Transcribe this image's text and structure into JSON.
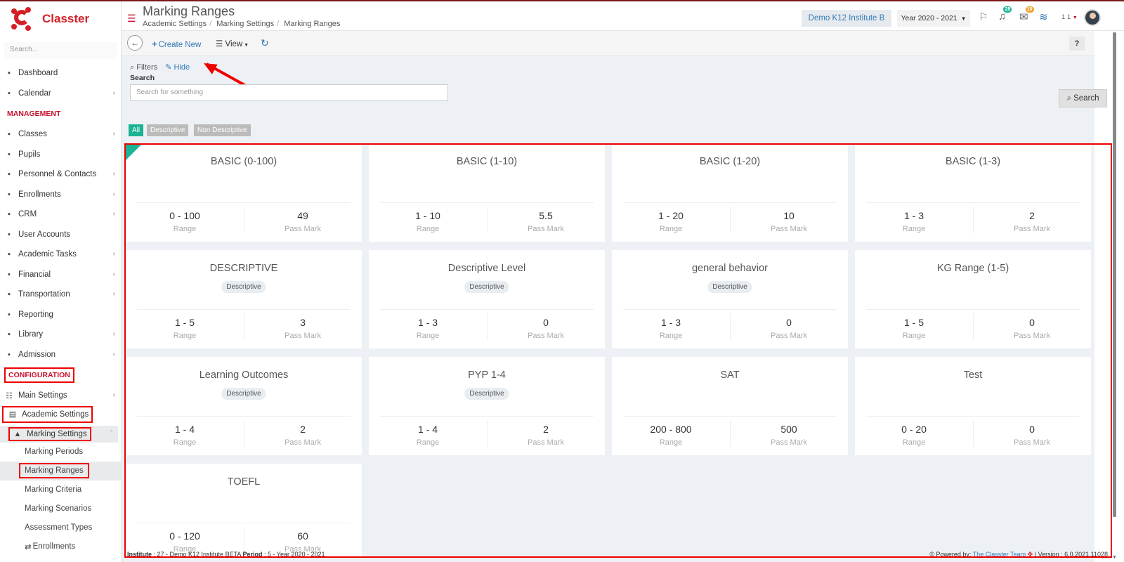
{
  "app": {
    "name": "Classter"
  },
  "sidebar": {
    "search_placeholder": "Search...",
    "items_top": [
      {
        "label": "Dashboard",
        "icon": "laptop-icon"
      },
      {
        "label": "Calendar",
        "icon": "calendar-icon"
      }
    ],
    "section_management": "MANAGEMENT",
    "items_management": [
      {
        "label": "Classes",
        "icon": "classes-icon"
      },
      {
        "label": "Pupils",
        "icon": "pupils-icon"
      },
      {
        "label": "Personnel & Contacts",
        "icon": "personnel-icon"
      },
      {
        "label": "Enrollments",
        "icon": "enrollments-icon"
      },
      {
        "label": "CRM",
        "icon": "crm-icon"
      },
      {
        "label": "User Accounts",
        "icon": "key-icon"
      },
      {
        "label": "Academic Tasks",
        "icon": "tasks-icon"
      },
      {
        "label": "Financial",
        "icon": "coins-icon"
      },
      {
        "label": "Transportation",
        "icon": "bus-icon"
      },
      {
        "label": "Reporting",
        "icon": "printer-icon"
      },
      {
        "label": "Library",
        "icon": "books-icon"
      },
      {
        "label": "Admission",
        "icon": "institution-icon"
      }
    ],
    "section_configuration": "CONFIGURATION",
    "main_settings": "Main Settings",
    "academic_settings": "Academic Settings",
    "marking_settings": "Marking Settings",
    "sub_items": [
      "Marking Periods",
      "Marking Ranges",
      "Marking Criteria",
      "Marking Scenarios",
      "Assessment Types"
    ],
    "enrollments_sub": "Enrollments"
  },
  "header": {
    "title": "Marking Ranges",
    "breadcrumbs": [
      "Academic Settings",
      "Marking Settings",
      "Marking Ranges"
    ],
    "institute": "Demo K12 Institute B",
    "year": "Year 2020 - 2021",
    "notifications_count": "28",
    "messages_count": "10",
    "user_num": "1 1"
  },
  "toolbar": {
    "create_label": "Create New",
    "view_label": "View",
    "help_label": "?"
  },
  "filters": {
    "label": "Filters",
    "hide_label": "Hide",
    "search_label": "Search",
    "search_placeholder": "Search for something",
    "search_button": "Search",
    "pills": [
      "All",
      "Descriptive",
      "Non Descriptive"
    ]
  },
  "cards": [
    {
      "title": "BASIC (0-100)",
      "tag": "",
      "range": "0 - 100",
      "pass": "49"
    },
    {
      "title": "BASIC (1-10)",
      "tag": "",
      "range": "1 - 10",
      "pass": "5.5"
    },
    {
      "title": "BASIC (1-20)",
      "tag": "",
      "range": "1 - 20",
      "pass": "10"
    },
    {
      "title": "BASIC (1-3)",
      "tag": "",
      "range": "1 - 3",
      "pass": "2"
    },
    {
      "title": "DESCRIPTIVE",
      "tag": "Descriptive",
      "range": "1 - 5",
      "pass": "3"
    },
    {
      "title": "Descriptive Level",
      "tag": "Descriptive",
      "range": "1 - 3",
      "pass": "0"
    },
    {
      "title": "general behavior",
      "tag": "Descriptive",
      "range": "1 - 3",
      "pass": "0"
    },
    {
      "title": "KG Range (1-5)",
      "tag": "",
      "range": "1 - 5",
      "pass": "0"
    },
    {
      "title": "Learning Outcomes",
      "tag": "Descriptive",
      "range": "1 - 4",
      "pass": "2"
    },
    {
      "title": "PYP 1-4",
      "tag": "Descriptive",
      "range": "1 - 4",
      "pass": "2"
    },
    {
      "title": "SAT",
      "tag": "",
      "range": "200 - 800",
      "pass": "500"
    },
    {
      "title": "Test",
      "tag": "",
      "range": "0 - 20",
      "pass": "0"
    },
    {
      "title": "TOEFL",
      "tag": "",
      "range": "0 - 120",
      "pass": "60"
    }
  ],
  "card_labels": {
    "range": "Range",
    "pass": "Pass Mark"
  },
  "footer": {
    "institute_label": "Institute",
    "institute_value": ": 27 - Demo K12 Institute BETA",
    "period_label": "Period",
    "period_value": ": 5 - Year 2020 - 2021",
    "powered_by": "Powered by:",
    "team": "The Classter Team",
    "version": "| Version : 6.0.2021.11028"
  },
  "colors": {
    "brand": "#d41f26",
    "accent": "#1ab394",
    "link": "#337ab7",
    "annotation": "#ee0000"
  }
}
